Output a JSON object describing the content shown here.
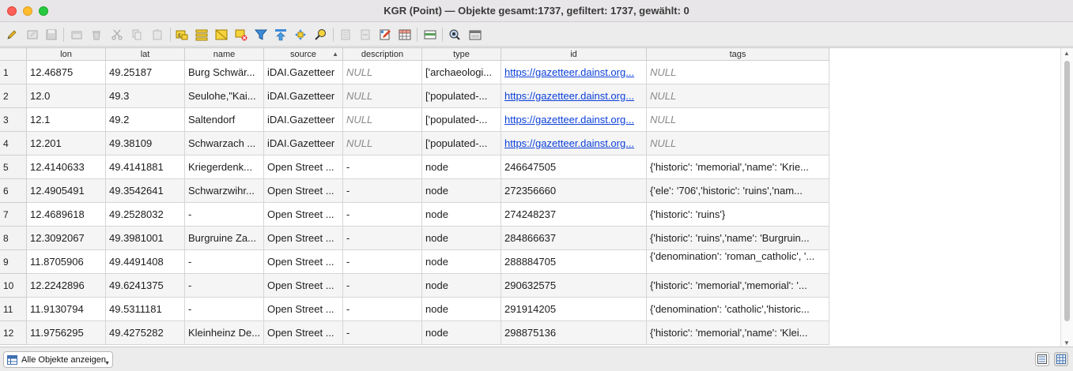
{
  "window": {
    "title": "KGR (Point) — Objekte gesamt:1737, gefiltert: 1737, gewählt: 0"
  },
  "columns": [
    {
      "key": "lon",
      "label": "lon"
    },
    {
      "key": "lat",
      "label": "lat"
    },
    {
      "key": "name",
      "label": "name"
    },
    {
      "key": "source",
      "label": "source"
    },
    {
      "key": "description",
      "label": "description"
    },
    {
      "key": "type",
      "label": "type"
    },
    {
      "key": "id",
      "label": "id"
    },
    {
      "key": "tags",
      "label": "tags"
    }
  ],
  "rows": [
    {
      "n": "1",
      "lon": "12.46875",
      "lat": "49.25187",
      "name": "Burg Schwär...",
      "source": "iDAI.Gazetteer",
      "description": "NULL",
      "type": "['archaeologi...",
      "id": "https://gazetteer.dainst.org...",
      "tags": "NULL"
    },
    {
      "n": "2",
      "lon": "12.0",
      "lat": "49.3",
      "name": "Seulohe,\"Kai...",
      "source": "iDAI.Gazetteer",
      "description": "NULL",
      "type": "['populated-...",
      "id": "https://gazetteer.dainst.org...",
      "tags": "NULL"
    },
    {
      "n": "3",
      "lon": "12.1",
      "lat": "49.2",
      "name": "Saltendorf",
      "source": "iDAI.Gazetteer",
      "description": "NULL",
      "type": "['populated-...",
      "id": "https://gazetteer.dainst.org...",
      "tags": "NULL"
    },
    {
      "n": "4",
      "lon": "12.201",
      "lat": "49.38109",
      "name": "Schwarzach ...",
      "source": "iDAI.Gazetteer",
      "description": "NULL",
      "type": "['populated-...",
      "id": "https://gazetteer.dainst.org...",
      "tags": "NULL"
    },
    {
      "n": "5",
      "lon": "12.4140633",
      "lat": "49.4141881",
      "name": "Kriegerdenk...",
      "source": "Open Street ...",
      "description": "-",
      "type": "node",
      "id": "246647505",
      "tags": "{'historic': 'memorial','name': 'Krie..."
    },
    {
      "n": "6",
      "lon": "12.4905491",
      "lat": "49.3542641",
      "name": "Schwarzwihr...",
      "source": "Open Street ...",
      "description": "-",
      "type": "node",
      "id": "272356660",
      "tags": "{'ele': '706','historic': 'ruins','nam..."
    },
    {
      "n": "7",
      "lon": "12.4689618",
      "lat": "49.2528032",
      "name": "-",
      "source": "Open Street ...",
      "description": "-",
      "type": "node",
      "id": "274248237",
      "tags": "{'historic': 'ruins'}"
    },
    {
      "n": "8",
      "lon": "12.3092067",
      "lat": "49.3981001",
      "name": "Burgruine Za...",
      "source": "Open Street ...",
      "description": "-",
      "type": "node",
      "id": "284866637",
      "tags": "{'historic': 'ruins','name': 'Burgruin..."
    },
    {
      "n": "9",
      "lon": "11.8705906",
      "lat": "49.4491408",
      "name": "-",
      "source": "Open Street ...",
      "description": "-",
      "type": "node",
      "id": "288884705",
      "tags": "{'denomination': 'roman_catholic', '..."
    },
    {
      "n": "10",
      "lon": "12.2242896",
      "lat": "49.6241375",
      "name": "-",
      "source": "Open Street ...",
      "description": "-",
      "type": "node",
      "id": "290632575",
      "tags": "{'historic': 'memorial','memorial': '..."
    },
    {
      "n": "11",
      "lon": "11.9130794",
      "lat": "49.5311181",
      "name": "-",
      "source": "Open Street ...",
      "description": "-",
      "type": "node",
      "id": "291914205",
      "tags": "{'denomination': 'catholic','historic..."
    },
    {
      "n": "12",
      "lon": "11.9756295",
      "lat": "49.4275282",
      "name": "Kleinheinz De...",
      "source": "Open Street ...",
      "description": "-",
      "type": "node",
      "id": "298875136",
      "tags": "{'historic': 'memorial','name': 'Klei..."
    }
  ],
  "sort": {
    "column": "source",
    "direction": "ascending"
  },
  "bottombar": {
    "filter_label": "Alle Objekte anzeigen"
  },
  "toolbar_icons": [
    "pencil-icon",
    "multi-edit-icon",
    "save-icon",
    "add-feature-icon",
    "delete-icon",
    "cut-icon",
    "copy-icon",
    "paste-icon",
    "select-expression-icon",
    "select-all-icon",
    "invert-selection-icon",
    "deselect-icon",
    "filter-icon",
    "move-selection-top-icon",
    "pan-to-selection-icon",
    "zoom-to-selection-icon",
    "new-field-icon",
    "delete-field-icon",
    "field-calculator-icon",
    "conditional-formatting-icon",
    "dock-icon",
    "actions-icon",
    "zoom-map-icon",
    "dock-window-icon"
  ],
  "colors": {
    "null_text": "#8a8a8a",
    "link": "#0b3fd8",
    "header_bg": "#f3f3f3"
  }
}
